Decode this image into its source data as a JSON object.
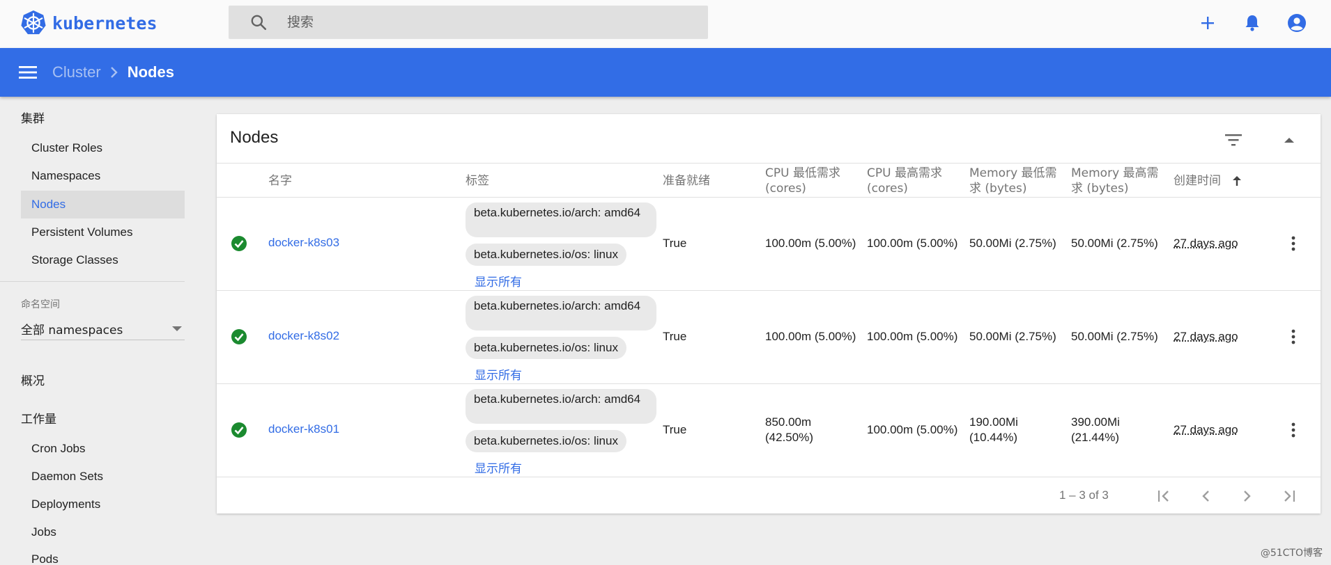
{
  "app": {
    "name": "kubernetes"
  },
  "search": {
    "placeholder": "搜索"
  },
  "topbar": {
    "actions": [
      "add-icon",
      "notifications-icon",
      "account-circle-icon"
    ]
  },
  "breadcrumb": {
    "parent": "Cluster",
    "current": "Nodes"
  },
  "sidebar": {
    "cluster_heading": "集群",
    "cluster_items": [
      {
        "label": "Cluster Roles",
        "active": false
      },
      {
        "label": "Namespaces",
        "active": false
      },
      {
        "label": "Nodes",
        "active": true
      },
      {
        "label": "Persistent Volumes",
        "active": false
      },
      {
        "label": "Storage Classes",
        "active": false
      }
    ],
    "namespace_label": "命名空间",
    "namespace_value": "全部 namespaces",
    "overview_heading": "概况",
    "workloads_heading": "工作量",
    "workload_items": [
      {
        "label": "Cron Jobs"
      },
      {
        "label": "Daemon Sets"
      },
      {
        "label": "Deployments"
      },
      {
        "label": "Jobs"
      },
      {
        "label": "Pods"
      }
    ]
  },
  "card": {
    "title": "Nodes",
    "columns": {
      "name": "名字",
      "labels": "标签",
      "ready": "准备就绪",
      "cpu_requests": "CPU 最低需求 (cores)",
      "cpu_limits": "CPU 最高需求 (cores)",
      "mem_requests": "Memory 最低需求 (bytes)",
      "mem_limits": "Memory 最高需求 (bytes)",
      "created": "创建时间"
    },
    "rows": [
      {
        "name": "docker-k8s03",
        "label_arch": "beta.kubernetes.io/arch: amd64",
        "label_os": "beta.kubernetes.io/os: linux",
        "show_all": "显示所有",
        "ready": "True",
        "cpu_requests": "100.00m (5.00%)",
        "cpu_limits": "100.00m (5.00%)",
        "mem_requests": "50.00Mi (2.75%)",
        "mem_limits": "50.00Mi (2.75%)",
        "age": "27 days ago"
      },
      {
        "name": "docker-k8s02",
        "label_arch": "beta.kubernetes.io/arch: amd64",
        "label_os": "beta.kubernetes.io/os: linux",
        "show_all": "显示所有",
        "ready": "True",
        "cpu_requests": "100.00m (5.00%)",
        "cpu_limits": "100.00m (5.00%)",
        "mem_requests": "50.00Mi (2.75%)",
        "mem_limits": "50.00Mi (2.75%)",
        "age": "27 days ago"
      },
      {
        "name": "docker-k8s01",
        "label_arch": "beta.kubernetes.io/arch: amd64",
        "label_os": "beta.kubernetes.io/os: linux",
        "show_all": "显示所有",
        "ready": "True",
        "cpu_requests": "850.00m (42.50%)",
        "cpu_limits": "100.00m (5.00%)",
        "mem_requests": "190.00Mi (10.44%)",
        "mem_limits": "390.00Mi (21.44%)",
        "age": "27 days ago"
      }
    ],
    "pagination": {
      "range": "1 – 3 of 3"
    }
  },
  "watermark": "@51CTO博客",
  "colors": {
    "brand": "#326ce5",
    "navbar": "#326de6",
    "ready_green": "#1b8a2f"
  }
}
